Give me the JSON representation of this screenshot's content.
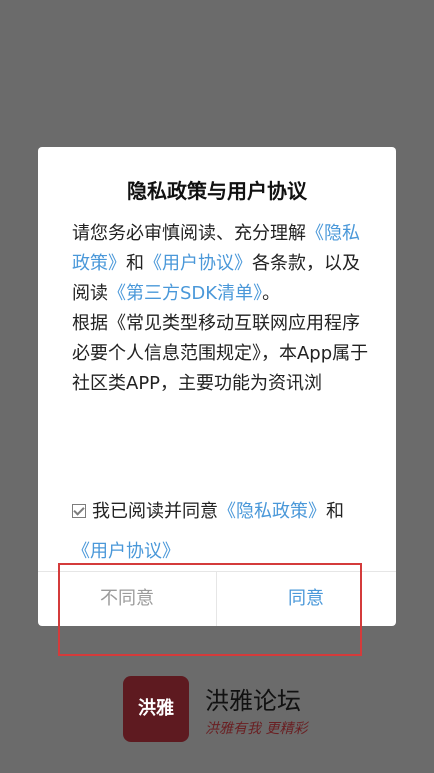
{
  "dialog": {
    "title": "隐私政策与用户协议",
    "content": {
      "p1_prefix": "请您务必审慎阅读、充分理解",
      "p1_link_privacy": "《隐私政策》",
      "p1_and": "和",
      "p1_link_user": "《用户协议》",
      "p1_suffix": "各条款，以及阅读",
      "p1_link_sdk": "《第三方SDK清单》",
      "p1_end": "。",
      "p2": "根据《常见类型移动互联网应用程序必要个人信息范围规定》，本App属于社区类APP，主要功能为资讯浏"
    },
    "agree": {
      "text": "我已阅读并同意",
      "link_privacy": "《隐私政策》",
      "and": "和",
      "link_user": "《用户协议》"
    },
    "buttons": {
      "disagree": "不同意",
      "agree": "同意"
    }
  },
  "brand": {
    "logo_text": "洪雅",
    "name": "洪雅论坛",
    "tagline": "洪雅有我 更精彩"
  },
  "colors": {
    "link": "#4a98d9",
    "highlight": "#d43b3b",
    "logo_bg": "#5e1a20",
    "overlay": "#6b6b6b"
  }
}
